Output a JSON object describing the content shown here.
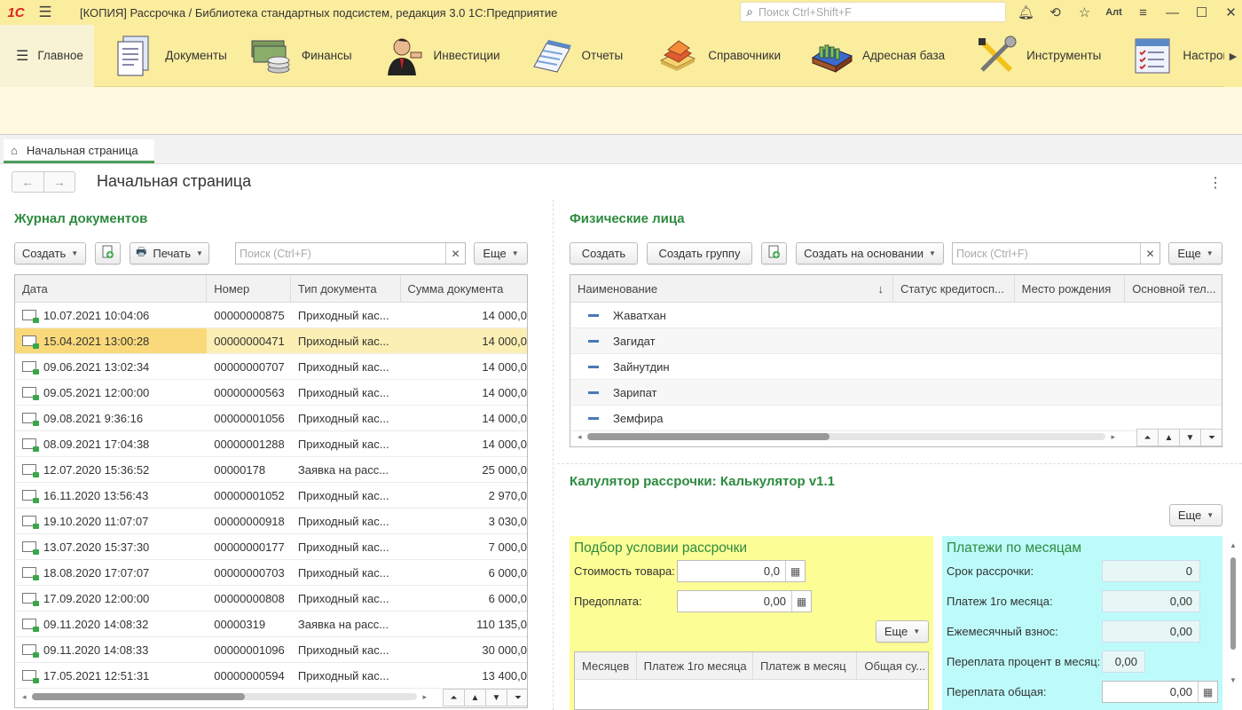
{
  "window": {
    "logo": "1С",
    "title": "[КОПИЯ] Рассрочка / Библиотека стандартных подсистем, редакция 3.0 1С:Предприятие",
    "search_placeholder": "Поиск Ctrl+Shift+F",
    "alt_label": "Алt"
  },
  "menu": {
    "main": "Главное",
    "items": [
      {
        "label": "Документы",
        "icon": "documents-icon"
      },
      {
        "label": "Финансы",
        "icon": "money-icon"
      },
      {
        "label": "Инвестиции",
        "icon": "investor-icon"
      },
      {
        "label": "Отчеты",
        "icon": "reports-icon"
      },
      {
        "label": "Справочники",
        "icon": "catalogs-icon"
      },
      {
        "label": "Адресная база",
        "icon": "address-box-icon"
      },
      {
        "label": "Инструменты",
        "icon": "tools-icon"
      },
      {
        "label": "Настройк",
        "icon": "settings-icon"
      }
    ]
  },
  "tab": {
    "label": "Начальная страница"
  },
  "page": {
    "title": "Начальная страница"
  },
  "journal": {
    "title": "Журнал документов",
    "create": "Создать",
    "print": "Печать",
    "search_placeholder": "Поиск (Ctrl+F)",
    "more": "Еще",
    "columns": [
      "Дата",
      "Номер",
      "Тип документа",
      "Сумма документа"
    ],
    "rows": [
      {
        "date": "10.07.2021 10:04:06",
        "num": "00000000875",
        "type": "Приходный кас...",
        "sum": "14 000,0"
      },
      {
        "date": "15.04.2021 13:00:28",
        "num": "00000000471",
        "type": "Приходный кас...",
        "sum": "14 000,0"
      },
      {
        "date": "09.06.2021 13:02:34",
        "num": "00000000707",
        "type": "Приходный кас...",
        "sum": "14 000,0"
      },
      {
        "date": "09.05.2021 12:00:00",
        "num": "00000000563",
        "type": "Приходный кас...",
        "sum": "14 000,0"
      },
      {
        "date": "09.08.2021 9:36:16",
        "num": "00000001056",
        "type": "Приходный кас...",
        "sum": "14 000,0"
      },
      {
        "date": "08.09.2021 17:04:38",
        "num": "00000001288",
        "type": "Приходный кас...",
        "sum": "14 000,0"
      },
      {
        "date": "12.07.2020 15:36:52",
        "num": "00000178",
        "type": "Заявка на расс...",
        "sum": "25 000,0"
      },
      {
        "date": "16.11.2020 13:56:43",
        "num": "00000001052",
        "type": "Приходный кас...",
        "sum": "2 970,0"
      },
      {
        "date": "19.10.2020 11:07:07",
        "num": "00000000918",
        "type": "Приходный кас...",
        "sum": "3 030,0"
      },
      {
        "date": "13.07.2020 15:37:30",
        "num": "00000000177",
        "type": "Приходный кас...",
        "sum": "7 000,0"
      },
      {
        "date": "18.08.2020 17:07:07",
        "num": "00000000703",
        "type": "Приходный кас...",
        "sum": "6 000,0"
      },
      {
        "date": "17.09.2020 12:00:00",
        "num": "00000000808",
        "type": "Приходный кас...",
        "sum": "6 000,0"
      },
      {
        "date": "09.11.2020 14:08:32",
        "num": "00000319",
        "type": "Заявка на расс...",
        "sum": "110 135,0"
      },
      {
        "date": "09.11.2020 14:08:33",
        "num": "00000001096",
        "type": "Приходный кас...",
        "sum": "30 000,0"
      },
      {
        "date": "17.05.2021 12:51:31",
        "num": "00000000594",
        "type": "Приходный кас...",
        "sum": "13 400,0"
      }
    ]
  },
  "persons": {
    "title": "Физические лица",
    "create": "Создать",
    "create_group": "Создать группу",
    "create_based": "Создать на основании",
    "search_placeholder": "Поиск (Ctrl+F)",
    "more": "Еще",
    "columns": [
      "Наименование",
      "Статус кредитосп...",
      "Место рождения",
      "Основной тел..."
    ],
    "sort_icon": "↓",
    "rows": [
      "Жаватхан",
      "Загидат",
      "Зайнутдин",
      "Зарипат",
      "Земфира"
    ]
  },
  "calculator": {
    "title": "Калулятор рассрочки: Калькулятор v1.1",
    "more": "Еще",
    "left": {
      "title": "Подбор условии рассрочки",
      "price_label": "Стоимость товара:",
      "price_value": "0,0",
      "prepay_label": "Предоплата:",
      "prepay_value": "0,00",
      "more": "Еще",
      "columns": [
        "Месяцев",
        "Платеж 1го месяца",
        "Платеж в месяц",
        "Общая су..."
      ]
    },
    "right": {
      "title": "Платежи по месяцам",
      "term_label": "Срок рассрочки:",
      "term_value": "0",
      "first_label": "Платеж 1го месяца:",
      "first_value": "0,00",
      "monthly_label": "Ежемесячный взнос:",
      "monthly_value": "0,00",
      "overpay_pct_label": "Переплата процент в месяц:",
      "overpay_pct_value": "0,00",
      "overpay_total_label": "Переплата общая:",
      "overpay_total_value": "0,00"
    }
  },
  "colors": {
    "accent_green": "#2d8a3f",
    "menu_bg": "#fbed9e",
    "selected_row": "#fcefb4"
  }
}
